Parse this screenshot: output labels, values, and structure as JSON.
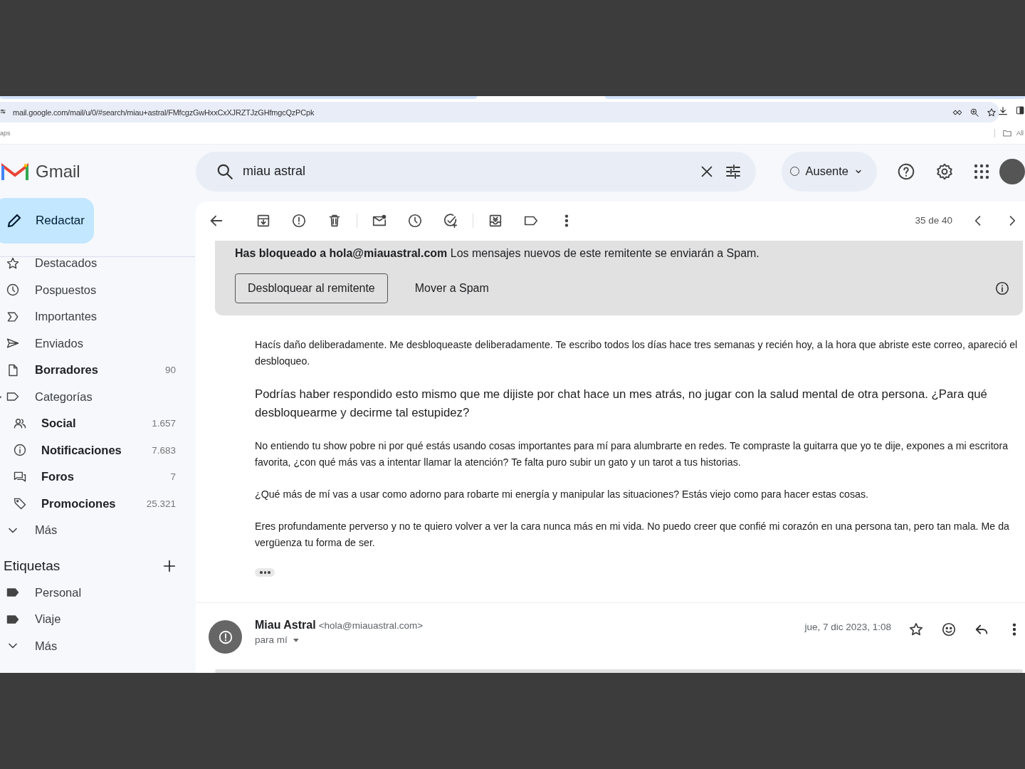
{
  "browser": {
    "url": "mail.google.com/mail/u/0/#search/miau+astral/FMfcgzGwHxxCxXJRZTJzGHfmgcQzPCpk",
    "bookmarks_left": "aps",
    "bookmarks_right": "All"
  },
  "app": {
    "name": "Gmail"
  },
  "compose": {
    "label": "Redactar"
  },
  "sidebar": {
    "items": [
      {
        "kind": "starred",
        "label": "Destacados",
        "unread": false
      },
      {
        "kind": "snoozed",
        "label": "Pospuestos",
        "unread": false
      },
      {
        "kind": "important",
        "label": "Importantes",
        "unread": false
      },
      {
        "kind": "sent",
        "label": "Enviados",
        "unread": false
      },
      {
        "kind": "drafts",
        "label": "Borradores",
        "count": "90",
        "unread": true
      },
      {
        "kind": "categories",
        "label": "Categorías",
        "unread": false,
        "expanded": true,
        "children": [
          {
            "kind": "social",
            "label": "Social",
            "count": "1.657",
            "unread": true
          },
          {
            "kind": "updates",
            "label": "Notificaciones",
            "count": "7.683",
            "unread": true
          },
          {
            "kind": "forums",
            "label": "Foros",
            "count": "7",
            "unread": true
          },
          {
            "kind": "promotions",
            "label": "Promociones",
            "count": "25.321",
            "unread": true
          }
        ]
      },
      {
        "kind": "more",
        "label": "Más",
        "unread": false
      }
    ]
  },
  "labels": {
    "title": "Etiquetas",
    "items": [
      {
        "kind": "label",
        "label": "Personal"
      },
      {
        "kind": "label",
        "label": "Viaje"
      },
      {
        "kind": "more",
        "label": "Más"
      }
    ]
  },
  "search": {
    "value": "miau astral"
  },
  "status": {
    "label": "Ausente"
  },
  "toolbar": {
    "position": "35 de 40"
  },
  "banner": {
    "text": "**Has bloqueado a hola@miauastral.com** Los mensajes nuevos de este remitente se enviarán a Spam.",
    "buttons": [
      "Desbloquear al remitente",
      "Mover a Spam"
    ]
  },
  "message": {
    "paragraphs": [
      {
        "kind": "normal",
        "text": "Hacís daño deliberadamente. Me desbloqueaste deliberadamente. Te escribo todos los días hace tres semanas y recién hoy, a la hora que abriste este correo, apareció el desbloqueo."
      },
      {
        "kind": "large",
        "text": "Podrías haber respondido esto mismo que me dijiste por chat hace un mes atrás, no jugar con la salud mental de otra persona. ¿Para qué desbloquearme y decirme tal estupidez?"
      },
      {
        "kind": "normal",
        "text": "No entiendo tu show pobre ni por qué estás usando cosas importantes para mí para alumbrarte en redes. Te compraste la guitarra que yo te dije, expones a mi escritora favorita, ¿con qué más vas a intentar llamar la atención? Te falta puro subir un gato y un tarot a tus historias."
      },
      {
        "kind": "normal",
        "text": "¿Qué más de mí vas a usar como adorno para robarte mi energía y manipular las situaciones? Estás viejo como para hacer estas cosas."
      },
      {
        "kind": "normal",
        "text": "Eres profundamente perverso y no te quiero volver a ver la cara nunca más en mi vida. No puedo creer que confié mi corazón en una persona tan, pero tan mala. Me da vergüenza tu forma de ser."
      }
    ]
  },
  "next_message": {
    "sender": "Miau Astral",
    "email": "<hola@miauastral.com>",
    "to": "para mí",
    "date": "jue, 7 dic 2023, 1:08"
  }
}
